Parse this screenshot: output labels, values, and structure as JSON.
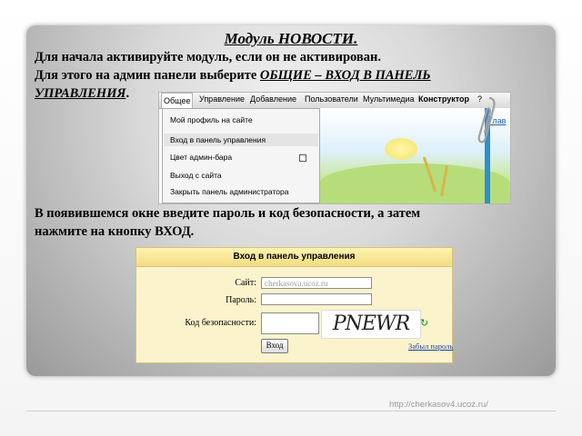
{
  "slide": {
    "title": "Модуль НОВОСТИ.",
    "line1": "Для начала активируйте модуль, если он не активирован.",
    "line2_prefix": "Для этого на админ панели выберите ",
    "line2_emph": "ОБЩИЕ – ВХОД В ПАНЕЛЬ",
    "line3_emph": "УПРАВЛЕНИЯ",
    "line3_suffix": ".",
    "line4": "В появившемся окне введите пароль и код безопасности, а затем",
    "line5": "нажмите на кнопку ВХОД.",
    "footer_url": "http://cherkasov4.ucoz.ru/"
  },
  "admin_menu": {
    "tabs": [
      "Общее",
      "Управление",
      "Добавление",
      "Пользователи",
      "Мультимедиа",
      "Конструктор",
      "?"
    ],
    "items": [
      "Мой профиль на сайте",
      "Вход в панель управления",
      "Цвет админ-бара",
      "Выход с сайта",
      "Закрыть панель администратора"
    ],
    "side_link": "Глав"
  },
  "login_form": {
    "header": "Вход в панель управления",
    "site_label": "Сайт:",
    "site_value": "cherkasova.ucoz.ru",
    "password_label": "Пароль:",
    "captcha_label": "Код безопасности:",
    "captcha_text": "PNEWR",
    "reload_icon": "↻",
    "submit": "Вход",
    "forgot": "Забыл пароль"
  },
  "colors": {
    "panel_gray": "#b0b0b0",
    "form_bg": "#fbf3cc",
    "link_blue": "#1a3f9e"
  }
}
